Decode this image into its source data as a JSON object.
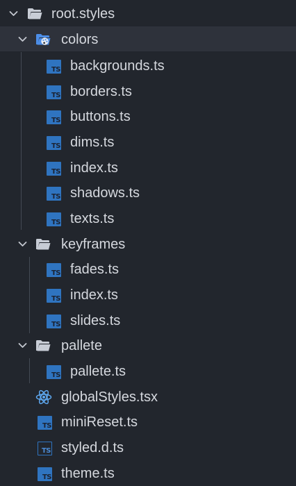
{
  "explorer": {
    "root": {
      "label": "root.styles",
      "icon": "folder-open-icon",
      "expanded": true
    },
    "colors": {
      "label": "colors",
      "icon": "palette-folder-icon",
      "expanded": true,
      "selected": true,
      "files": [
        {
          "label": "backgrounds.ts",
          "icon": "typescript-icon",
          "badge": "TS"
        },
        {
          "label": "borders.ts",
          "icon": "typescript-icon",
          "badge": "TS"
        },
        {
          "label": "buttons.ts",
          "icon": "typescript-icon",
          "badge": "TS"
        },
        {
          "label": "dims.ts",
          "icon": "typescript-icon",
          "badge": "TS"
        },
        {
          "label": "index.ts",
          "icon": "typescript-icon",
          "badge": "TS"
        },
        {
          "label": "shadows.ts",
          "icon": "typescript-icon",
          "badge": "TS"
        },
        {
          "label": "texts.ts",
          "icon": "typescript-icon",
          "badge": "TS"
        }
      ]
    },
    "keyframes": {
      "label": "keyframes",
      "icon": "folder-open-icon",
      "expanded": true,
      "files": [
        {
          "label": "fades.ts",
          "icon": "typescript-icon",
          "badge": "TS"
        },
        {
          "label": "index.ts",
          "icon": "typescript-icon",
          "badge": "TS"
        },
        {
          "label": "slides.ts",
          "icon": "typescript-icon",
          "badge": "TS"
        }
      ]
    },
    "pallete": {
      "label": "pallete",
      "icon": "folder-open-icon",
      "expanded": true,
      "files": [
        {
          "label": "pallete.ts",
          "icon": "typescript-icon",
          "badge": "TS"
        }
      ]
    },
    "rootFiles": [
      {
        "label": "globalStyles.tsx",
        "icon": "react-icon"
      },
      {
        "label": "miniReset.ts",
        "icon": "typescript-icon",
        "badge": "TS"
      },
      {
        "label": "styled.d.ts",
        "icon": "typescript-definition-icon",
        "badge": "TS"
      },
      {
        "label": "theme.ts",
        "icon": "typescript-icon",
        "badge": "TS"
      }
    ]
  },
  "colors": {
    "background": "#22262d",
    "selectedRow": "#2e323b",
    "text": "#d5d8de",
    "folder": "#c8cdd6",
    "folderAccent": "#4c8ee8",
    "tsBlue": "#2f74c0",
    "react": "#5ea8f0",
    "guide": "#444a54"
  }
}
